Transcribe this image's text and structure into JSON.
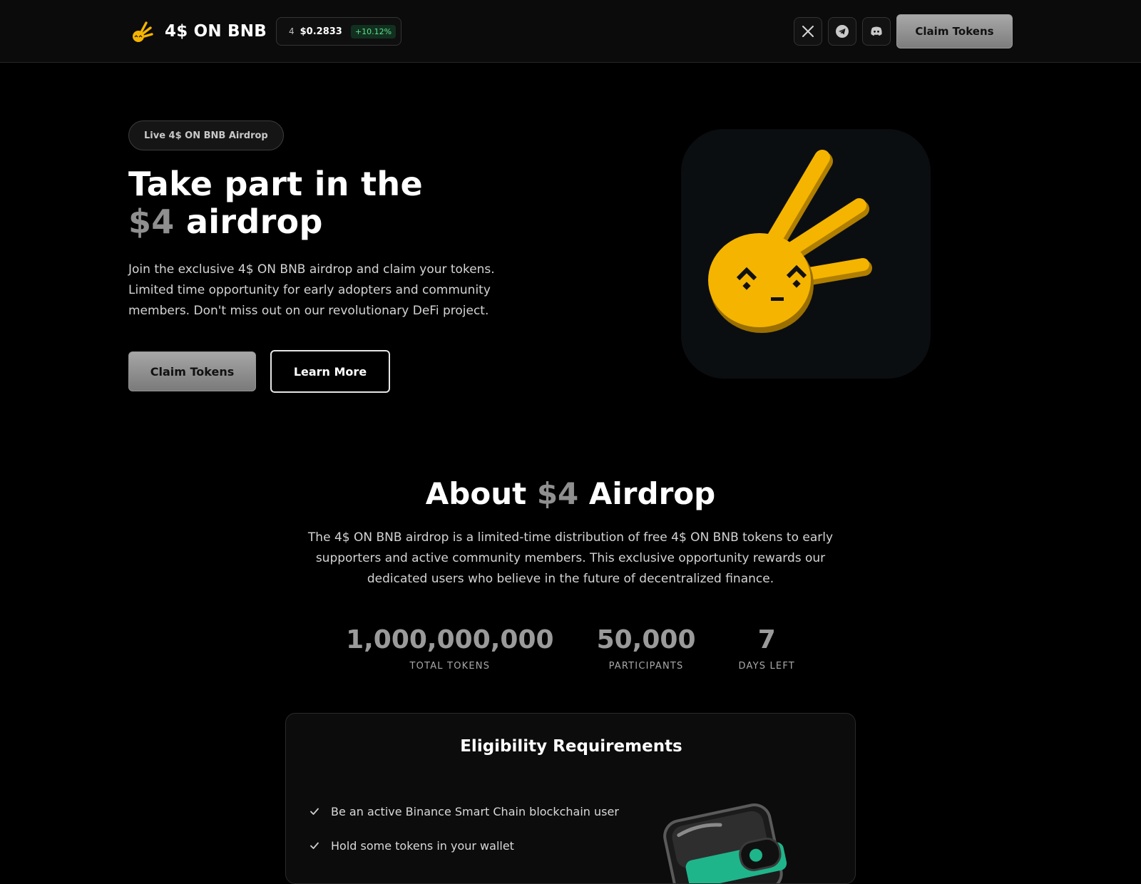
{
  "header": {
    "brand_name": "4$ ON BNB",
    "ticker": {
      "symbol": "4",
      "price": "$0.2833",
      "change": "+10.12%"
    },
    "social": [
      {
        "icon": "x-icon"
      },
      {
        "icon": "telegram-icon"
      },
      {
        "icon": "discord-icon"
      }
    ],
    "claim_label": "Claim Tokens"
  },
  "hero": {
    "badge": "Live 4$ ON BNB Airdrop",
    "title_line1": "Take part in the",
    "title_accent": "$4",
    "title_rest": "airdrop",
    "description": "Join the exclusive 4$ ON BNB airdrop and claim your tokens. Limited time opportunity for early adopters and community members. Don't miss out on our revolutionary DeFi project.",
    "claim_label": "Claim Tokens",
    "learn_label": "Learn More",
    "mascot_icon": "hand-mascot-icon"
  },
  "about": {
    "title_prefix": "About",
    "title_accent": "$4",
    "title_suffix": "Airdrop",
    "description": "The 4$ ON BNB airdrop is a limited-time distribution of free 4$ ON BNB tokens to early supporters and active community members. This exclusive opportunity rewards our dedicated users who believe in the future of decentralized finance.",
    "stats": [
      {
        "value": "1,000,000,000",
        "label": "TOTAL TOKENS"
      },
      {
        "value": "50,000",
        "label": "PARTICIPANTS"
      },
      {
        "value": "7",
        "label": "DAYS LEFT"
      }
    ]
  },
  "eligibility": {
    "title": "Eligibility Requirements",
    "items": [
      "Be an active Binance Smart Chain blockchain user",
      "Hold some tokens in your wallet"
    ],
    "graphic_icon": "wallet-icon"
  },
  "colors": {
    "accent_gray": "#8f8f8f",
    "mascot_yellow": "#f5b400",
    "positive_green": "#5fe08a",
    "background": "#000000"
  }
}
